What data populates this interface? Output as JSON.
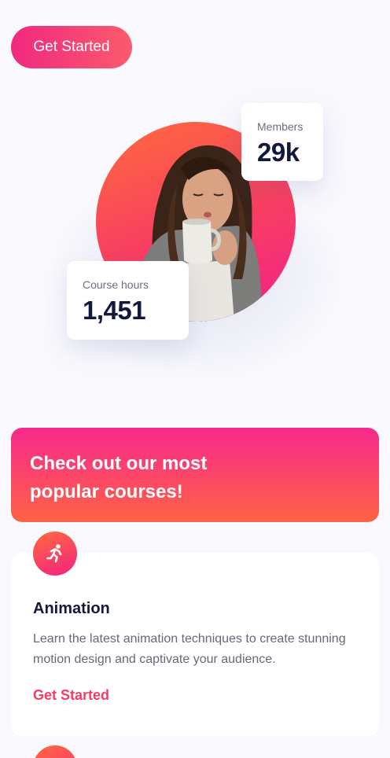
{
  "header": {
    "cta_label": "Get Started"
  },
  "hero": {
    "stats": {
      "members": {
        "label": "Members",
        "value": "29k"
      },
      "course_hours": {
        "label": "Course hours",
        "value": "1,451"
      }
    }
  },
  "banner": {
    "title": "Check out our most popular courses!"
  },
  "courses": [
    {
      "icon": "running-person-icon",
      "title": "Animation",
      "description": "Learn the latest animation techniques to create stunning motion design and captivate your audience.",
      "link_label": "Get Started"
    }
  ],
  "colors": {
    "accent_pink": "#f0297f",
    "accent_orange": "#ff6245",
    "link": "#f73b63",
    "heading": "#13183f",
    "background": "#f8f8fd"
  }
}
